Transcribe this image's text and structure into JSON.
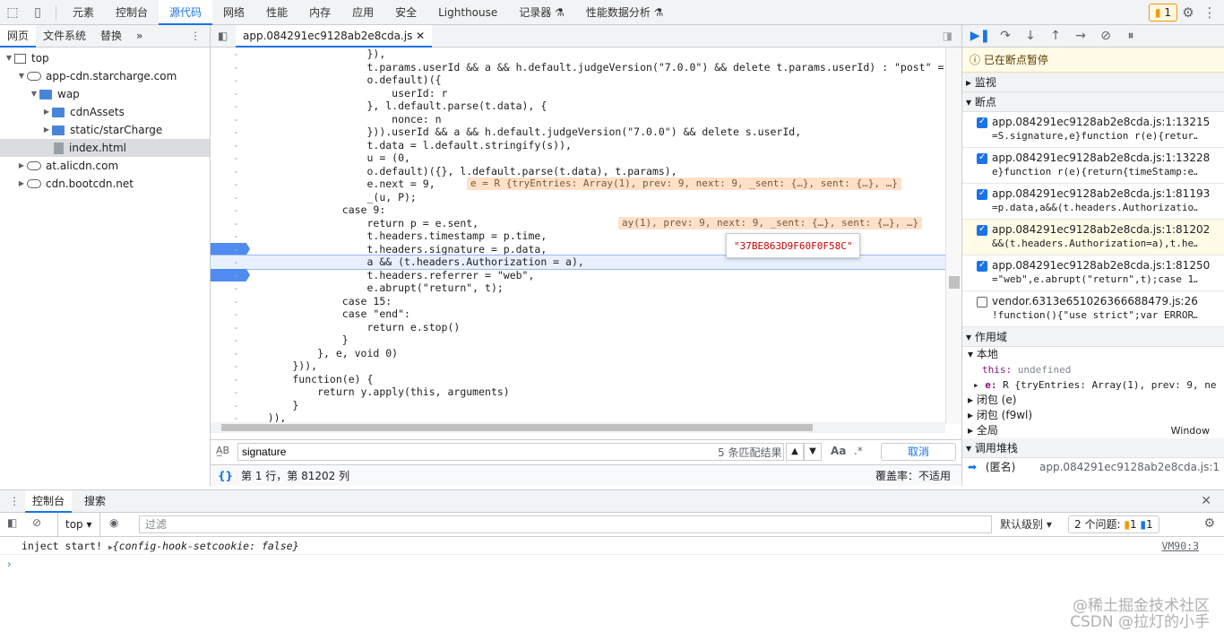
{
  "toolbar": {
    "tabs": [
      "元素",
      "控制台",
      "源代码",
      "网络",
      "性能",
      "内存",
      "应用",
      "安全",
      "Lighthouse",
      "记录器 ⚗",
      "性能数据分析 ⚗"
    ],
    "active_tab": "源代码",
    "issues_count": "1"
  },
  "navigator": {
    "tabs": [
      "网页",
      "文件系统",
      "替换"
    ],
    "more": "»",
    "tree": [
      {
        "label": "top",
        "indent": 0,
        "kind": "frame",
        "open": true
      },
      {
        "label": "app-cdn.starcharge.com",
        "indent": 1,
        "kind": "cloud",
        "open": true
      },
      {
        "label": "wap",
        "indent": 2,
        "kind": "folder",
        "open": true
      },
      {
        "label": "cdnAssets",
        "indent": 3,
        "kind": "folder",
        "open": false
      },
      {
        "label": "static/starCharge",
        "indent": 3,
        "kind": "folder",
        "open": false
      },
      {
        "label": "index.html",
        "indent": 3,
        "kind": "file",
        "selected": true
      },
      {
        "label": "at.alicdn.com",
        "indent": 1,
        "kind": "cloud",
        "open": false
      },
      {
        "label": "cdn.bootcdn.net",
        "indent": 1,
        "kind": "cloud",
        "open": false
      }
    ]
  },
  "editor": {
    "filename": "app.084291ec9128ab2e8cda.js",
    "tooltip": "\"37BE863D9F60F0F58C\"",
    "search_value": "signature",
    "match_text": "5 条匹配结果",
    "cancel": "取消",
    "match_case": "Aa",
    "regex": ".*",
    "status_position": "第 1 行，第 81202 列",
    "coverage": "覆盖率：不适用",
    "status_braces": "{}",
    "lines": [
      "                    }),",
      "                    t.params.userId && a && h.default.judgeVersion(\"7.0.0\") && delete t.params.userId) : \"post\" =",
      "                    o.default)({",
      "                        userId: r",
      "                    }, l.default.parse(t.data), {",
      "                        nonce: n",
      "                    })).userId && a && h.default.judgeVersion(\"7.0.0\") && delete s.userId,",
      "                    t.data = l.default.stringify(s)),",
      "                    u = (0,",
      "                    o.default)({}, l.default.parse(t.data), t.params),",
      "                    e.next = 9,",
      "                    _(u, P);",
      "                case 9:",
      "                    return p = e.sent,",
      "                    t.headers.timestamp = p.time,",
      "                    t.headers.signature = p.data,",
      "                    a && (t.headers.Authorization = a),",
      "                    t.headers.referrer = \"web\",",
      "                    e.abrupt(\"return\", t);",
      "                case 15:",
      "                case \"end\":",
      "                    return e.stop()",
      "                }",
      "            }, e, void 0)",
      "        })),",
      "        function(e) {",
      "            return y.apply(this, arguments)",
      "        }",
      "    )),"
    ],
    "inline_values": [
      {
        "line": 10,
        "text": "e = R {tryEntries: Array(1), prev: 9, next: 9, _sent: {…}, sent: {…}, …}"
      },
      {
        "line": 13,
        "text": "ay(1), prev: 9, next: 9, _sent: {…}, sent: {…}, …}"
      }
    ]
  },
  "debugger": {
    "paused": "已在断点暂停",
    "watch": "监视",
    "breakpoints_title": "断点",
    "breakpoints": [
      {
        "loc": "app.084291ec9128ab2e8cda.js:1:13215",
        "src": "=S.signature,e}function r(e){retur…",
        "checked": true
      },
      {
        "loc": "app.084291ec9128ab2e8cda.js:1:13228",
        "src": "e}function r(e){return{timeStamp:e…",
        "checked": true
      },
      {
        "loc": "app.084291ec9128ab2e8cda.js:1:81193",
        "src": "=p.data,a&&(t.headers.Authorizatio…",
        "checked": true
      },
      {
        "loc": "app.084291ec9128ab2e8cda.js:1:81202",
        "src": "&&(t.headers.Authorization=a),t.he…",
        "checked": true,
        "active": true
      },
      {
        "loc": "app.084291ec9128ab2e8cda.js:1:81250",
        "src": "=\"web\",e.abrupt(\"return\",t);case 1…",
        "checked": true
      },
      {
        "loc": "vendor.6313e651026366688479.js:26",
        "src": "!function(){\"use strict\";var ERROR…",
        "checked": false
      }
    ],
    "scope_title": "作用域",
    "local": "本地",
    "this_label": "this:",
    "this_value": "undefined",
    "e_label": "e:",
    "e_value": "R {tryEntries: Array(1), prev: 9, ne",
    "closure1": "闭包 (e)",
    "closure2": "闭包 (f9wl)",
    "global": "全局",
    "global_value": "Window",
    "callstack_title": "调用堆栈",
    "call_name": "(匿名)",
    "call_loc": "app.084291ec9128ab2e8cda.js:1"
  },
  "drawer": {
    "tabs": [
      "控制台",
      "搜索"
    ],
    "context": "top",
    "filter_placeholder": "过滤",
    "level": "默认级别",
    "issues": "2 个问题:",
    "issue_warn": "1",
    "issue_info": "1",
    "log_text": "inject start!",
    "log_obj": "{config-hook-setcookie: false}",
    "log_src": "VM90:3",
    "prompt": "›"
  },
  "watermark": {
    "line1": "@稀土掘金技术社区",
    "line2": "CSDN @拉灯的小手"
  }
}
